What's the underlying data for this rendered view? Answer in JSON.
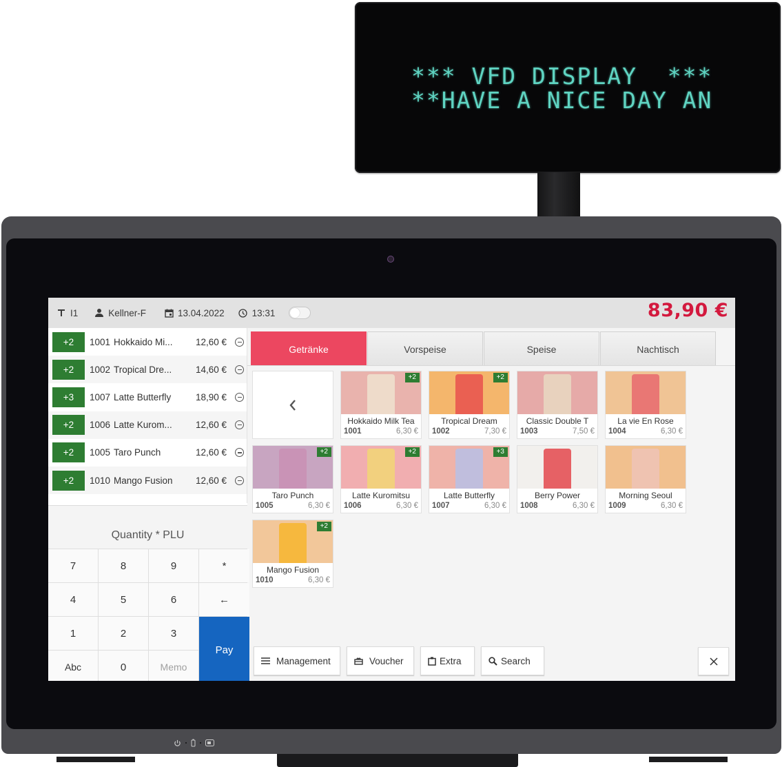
{
  "vfd": {
    "line1": "*** VFD DISPLAY  ***",
    "line2": "**HAVE A NICE DAY AN"
  },
  "topbar": {
    "table": "I1",
    "table_icon": "table-icon",
    "user": "Kellner-F",
    "user_icon": "person-icon",
    "date": "13.04.2022",
    "date_icon": "calendar-icon",
    "time": "13:31",
    "time_icon": "clock-icon",
    "toggle_on": false,
    "total": "83,90 €",
    "total_color": "#d3193e"
  },
  "orders": [
    {
      "qty": "+2",
      "plu": "1001",
      "name": "Hokkaido Mi...",
      "price": "12,60 €"
    },
    {
      "qty": "+2",
      "plu": "1002",
      "name": "Tropical Dre...",
      "price": "14,60 €"
    },
    {
      "qty": "+3",
      "plu": "1007",
      "name": "Latte Butterfly",
      "price": "18,90 €"
    },
    {
      "qty": "+2",
      "plu": "1006",
      "name": "Latte Kurom...",
      "price": "12,60 €"
    },
    {
      "qty": "+2",
      "plu": "1005",
      "name": "Taro Punch",
      "price": "12,60 €"
    },
    {
      "qty": "+2",
      "plu": "1010",
      "name": "Mango Fusion",
      "price": "12,60 €"
    }
  ],
  "keypad": {
    "label": "Quantity * PLU",
    "keys": [
      "7",
      "8",
      "9",
      "*",
      "4",
      "5",
      "6",
      "←",
      "1",
      "2",
      "3",
      "Abc",
      "0",
      "Memo"
    ],
    "pay": "Pay",
    "pay_color": "#1565c0"
  },
  "tabs": [
    {
      "label": "Getränke",
      "active": true
    },
    {
      "label": "Vorspeise",
      "active": false
    },
    {
      "label": "Speise",
      "active": false
    },
    {
      "label": "Nachtisch",
      "active": false
    }
  ],
  "accent_color": "#ec4760",
  "badge_color": "#2e7d32",
  "products": [
    {
      "name": "Hokkaido Milk Tea",
      "plu": "1001",
      "price": "6,30 €",
      "badge": "+2",
      "bg": "#e9b3ad",
      "cup": "#efe2cf"
    },
    {
      "name": "Tropical Dream",
      "plu": "1002",
      "price": "7,30 €",
      "badge": "+2",
      "bg": "#f4b66c",
      "cup": "#e8514e"
    },
    {
      "name": "Classic Double T",
      "plu": "1003",
      "price": "7,50 €",
      "badge": "",
      "bg": "#e6aaa8",
      "cup": "#e7d9c2"
    },
    {
      "name": "La vie En Rose",
      "plu": "1004",
      "price": "6,30 €",
      "badge": "",
      "bg": "#f0c495",
      "cup": "#e86a6e"
    },
    {
      "name": "Taro Punch",
      "plu": "1005",
      "price": "6,30 €",
      "badge": "+2",
      "bg": "#c8a5c1",
      "cup": "#c98fb4"
    },
    {
      "name": "Latte Kuromitsu",
      "plu": "1006",
      "price": "6,30 €",
      "badge": "+2",
      "bg": "#f1aeb0",
      "cup": "#f2d675"
    },
    {
      "name": "Latte Butterfly",
      "plu": "1007",
      "price": "6,30 €",
      "badge": "+3",
      "bg": "#efb3a9",
      "cup": "#b7bfe6"
    },
    {
      "name": "Berry Power",
      "plu": "1008",
      "price": "6,30 €",
      "badge": "",
      "bg": "#f2f0ed",
      "cup": "#e4484c"
    },
    {
      "name": "Morning Seoul",
      "plu": "1009",
      "price": "6,30 €",
      "badge": "",
      "bg": "#f1c08e",
      "cup": "#efc3b7"
    },
    {
      "name": "Mango Fusion",
      "plu": "1010",
      "price": "6,30 €",
      "badge": "+2",
      "bg": "#f2c79a",
      "cup": "#f7b52e"
    }
  ],
  "actions": {
    "management": "Management",
    "voucher": "Voucher",
    "extra": "Extra",
    "search": "Search"
  }
}
